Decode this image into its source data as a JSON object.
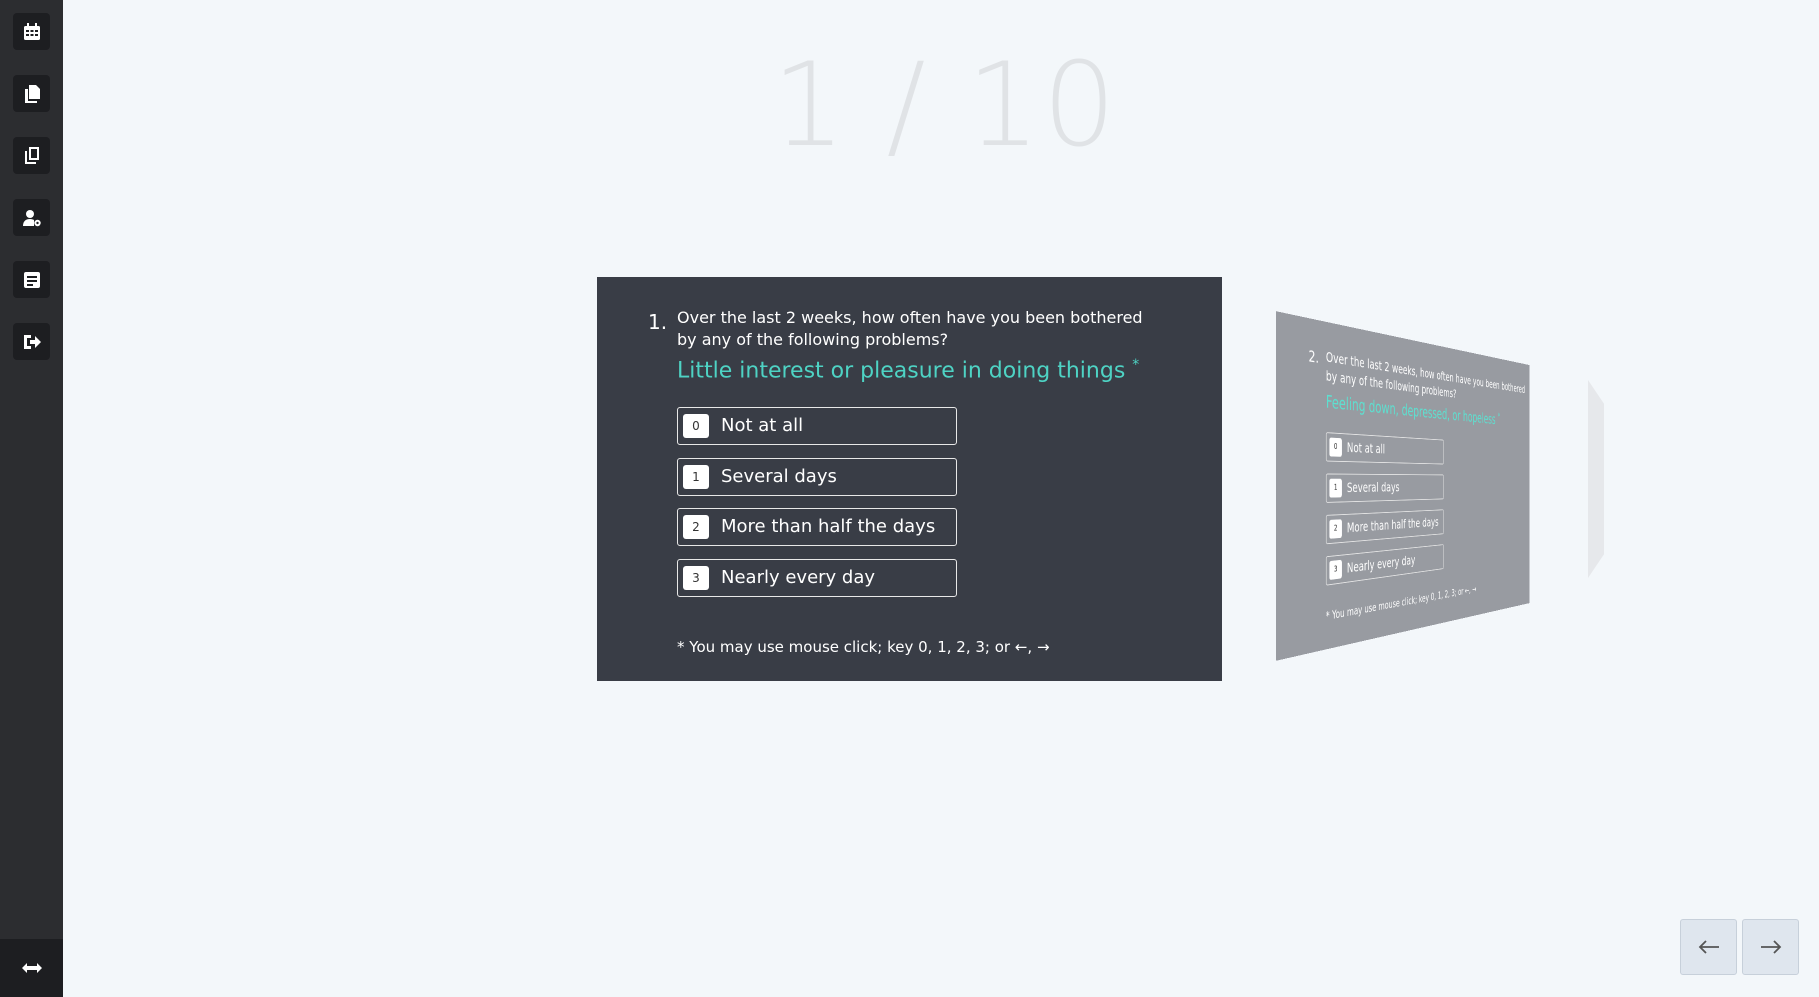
{
  "sidebar": {
    "items": [
      {
        "icon": "calendar-icon"
      },
      {
        "icon": "documents-icon"
      },
      {
        "icon": "copy-icon"
      },
      {
        "icon": "user-settings-icon"
      },
      {
        "icon": "form-icon"
      },
      {
        "icon": "logout-icon"
      }
    ],
    "bottom_icon": "expand-horizontal-icon"
  },
  "counter": {
    "current": "1",
    "separator": "/",
    "total": "10"
  },
  "question1": {
    "number": "1.",
    "text": "Over the last 2 weeks, how often have you been bothered by any of the following problems?",
    "item": "Little interest or pleasure in doing things",
    "required_mark": "*",
    "options": [
      {
        "key": "0",
        "label": "Not at all"
      },
      {
        "key": "1",
        "label": "Several days"
      },
      {
        "key": "2",
        "label": "More than half the days"
      },
      {
        "key": "3",
        "label": "Nearly every day"
      }
    ],
    "hint": "* You may use mouse click; key 0, 1, 2, 3; or ←, →"
  },
  "question2": {
    "number": "2.",
    "text": "Over the last 2 weeks, how often have you been bothered by any of the following problems?",
    "item": "Feeling down, depressed, or hopeless",
    "required_mark": "*",
    "options": [
      {
        "key": "0",
        "label": "Not at all"
      },
      {
        "key": "1",
        "label": "Several days"
      },
      {
        "key": "2",
        "label": "More than half the days"
      },
      {
        "key": "3",
        "label": "Nearly every day"
      }
    ],
    "hint": "* You may use mouse click; key 0, 1, 2, 3; or ←, →"
  },
  "nav": {
    "prev_icon": "arrow-left-icon",
    "next_icon": "arrow-right-icon"
  },
  "colors": {
    "accent": "#4ed3c4",
    "card_bg": "#393d46",
    "sidebar_bg": "#2c2d30"
  }
}
